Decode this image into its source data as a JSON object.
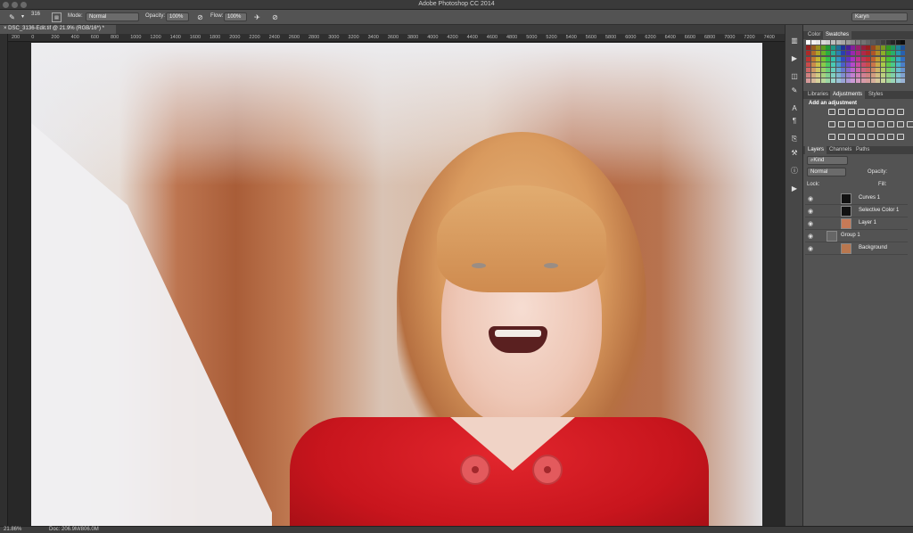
{
  "window": {
    "title": "Adobe Photoshop CC 2014"
  },
  "options_bar": {
    "brush_size": "316",
    "mode_label": "Mode:",
    "mode_value": "Normal",
    "opacity_label": "Opacity:",
    "opacity_value": "100%",
    "flow_label": "Flow:",
    "flow_value": "100%",
    "workspace": "Karyn"
  },
  "document_tab": {
    "label": "DSC_3136-Edit.tif @ 21.9% (RGB/16*) *"
  },
  "ruler_ticks": [
    "200",
    "0",
    "200",
    "400",
    "600",
    "800",
    "1000",
    "1200",
    "1400",
    "1600",
    "1800",
    "2000",
    "2200",
    "2400",
    "2600",
    "2800",
    "3000",
    "3200",
    "3400",
    "3600",
    "3800",
    "4000",
    "4200",
    "4400",
    "4600",
    "4800",
    "5000",
    "5200",
    "5400",
    "5600",
    "5800",
    "6000",
    "6200",
    "6400",
    "6600",
    "6800",
    "7000",
    "7200",
    "7400"
  ],
  "panels": {
    "color_tabs": [
      "Color",
      "Swatches"
    ],
    "color_active": "Swatches",
    "adjust_tabs": [
      "Libraries",
      "Adjustments",
      "Styles"
    ],
    "adjust_active": "Adjustments",
    "adjust_title": "Add an adjustment",
    "layer_tabs": [
      "Layers",
      "Channels",
      "Paths"
    ],
    "layers_active": "Layers",
    "kind_filter": "Kind",
    "blend_mode": "Normal",
    "opacity_label": "Opacity:",
    "lock_label": "Lock:",
    "fill_label": "Fill:",
    "layers": [
      {
        "name": "Curves 1"
      },
      {
        "name": "Selective Color 1"
      },
      {
        "name": "Layer 1"
      },
      {
        "name": "Group 1"
      },
      {
        "name": "Background"
      }
    ]
  },
  "status": {
    "zoom": "21.86%",
    "doc": "Doc: 206.9M/806.0M"
  },
  "colors": {
    "accent": "#535353",
    "panel_bg": "#535353",
    "canvas_bg": "#282828"
  }
}
